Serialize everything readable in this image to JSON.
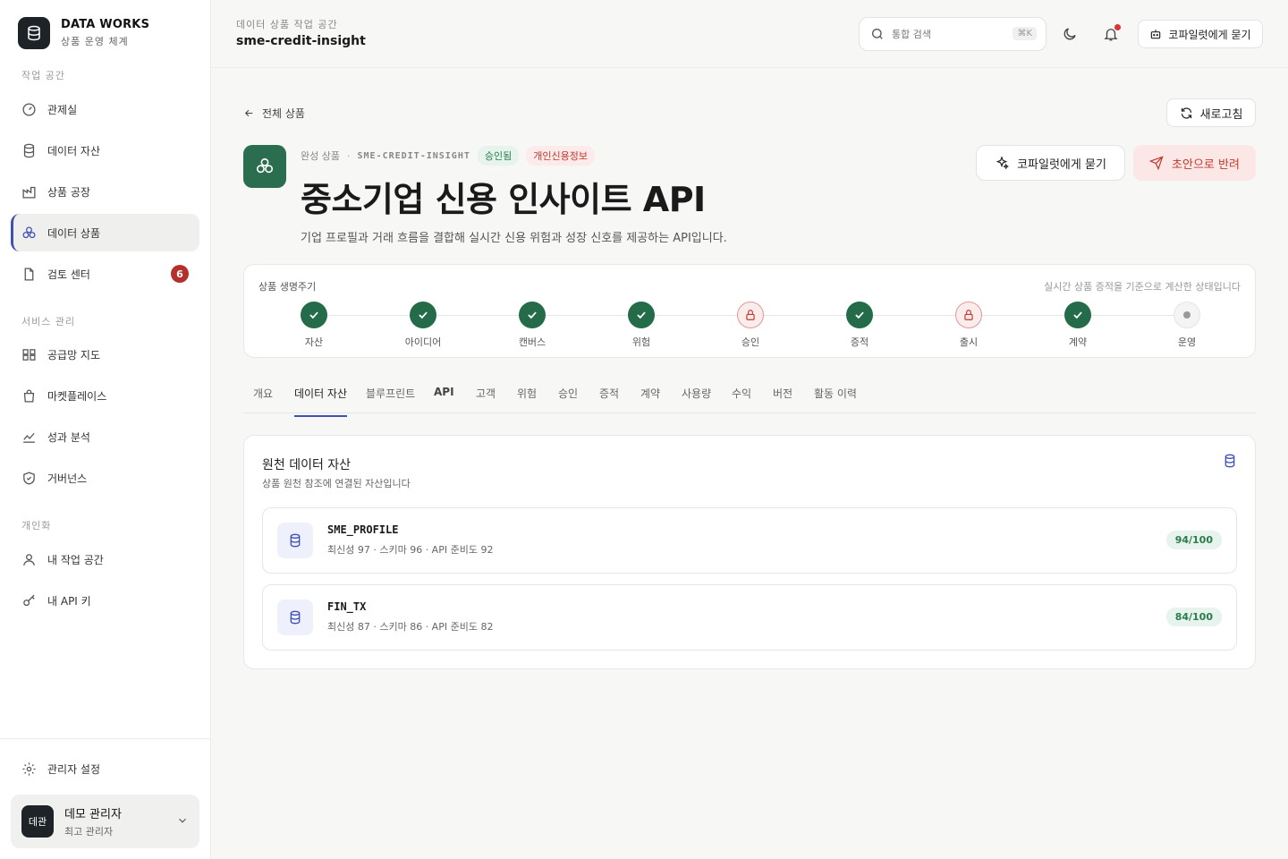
{
  "brand": {
    "title": "DATA WORKS",
    "subtitle": "상품 운영 체계"
  },
  "sidebar": {
    "section_workspace": "작업 공간",
    "section_service": "서비스 관리",
    "section_personal": "개인화",
    "items": [
      {
        "label": "관제실",
        "icon": "gauge-icon"
      },
      {
        "label": "데이터 자산",
        "icon": "database-icon"
      },
      {
        "label": "상품 공장",
        "icon": "factory-icon"
      },
      {
        "label": "데이터 상품",
        "icon": "cubes-icon",
        "active": true
      },
      {
        "label": "검토 센터",
        "icon": "file-check-icon",
        "badge": "6"
      },
      {
        "label": "공급망 지도",
        "icon": "network-icon"
      },
      {
        "label": "마켓플레이스",
        "icon": "store-icon"
      },
      {
        "label": "성과 분석",
        "icon": "chart-icon"
      },
      {
        "label": "거버넌스",
        "icon": "shield-icon"
      },
      {
        "label": "내 작업 공간",
        "icon": "user-icon"
      },
      {
        "label": "내 API 키",
        "icon": "key-icon"
      }
    ],
    "admin_settings": "관리자 설정",
    "user": {
      "avatar": "데관",
      "name": "데모 관리자",
      "role": "최고 관리자"
    }
  },
  "topbar": {
    "crumb_sub": "데이터 상품 작업 공간",
    "crumb_title": "sme-credit-insight",
    "search_placeholder": "통합 검색",
    "search_shortcut": "⌘K",
    "copilot_label": "코파일럿에게 묻기"
  },
  "page": {
    "back_label": "전체 상품",
    "refresh_label": "새로고침",
    "meta_status": "완성 상품",
    "meta_code": "SME-CREDIT-INSIGHT",
    "pill_approved": "승인됨",
    "pill_pii": "개인신용정보",
    "title_main": "중소기업 신용 인사이트 ",
    "title_bold": "API",
    "description": "기업 프로필과 거래 흐름을 결합해 실시간 신용 위험과 성장 신호를 제공하는 API입니다.",
    "btn_copilot": "코파일럿에게 묻기",
    "btn_return": "초안으로 반려"
  },
  "lifecycle": {
    "title": "상품 생명주기",
    "note": "실시간 상품 증적을 기준으로 계산한 상태입니다",
    "steps": [
      {
        "label": "자산",
        "state": "done"
      },
      {
        "label": "아이디어",
        "state": "done"
      },
      {
        "label": "캔버스",
        "state": "done"
      },
      {
        "label": "위험",
        "state": "done"
      },
      {
        "label": "승인",
        "state": "locked"
      },
      {
        "label": "증적",
        "state": "done"
      },
      {
        "label": "출시",
        "state": "locked"
      },
      {
        "label": "계약",
        "state": "done"
      },
      {
        "label": "운영",
        "state": "pending"
      }
    ]
  },
  "tabs": [
    "개요",
    "데이터 자산",
    "블루프린트",
    "API",
    "고객",
    "위험",
    "승인",
    "증적",
    "계약",
    "사용량",
    "수익",
    "버전",
    "활동 이력"
  ],
  "active_tab": "데이터 자산",
  "assets": {
    "title": "원천 데이터 자산",
    "subtitle": "상품 원천 참조에 연결된 자산입니다",
    "rows": [
      {
        "name": "SME_PROFILE",
        "meta": "최신성 97 · 스키마 96 · API 준비도 92",
        "score": "94/100"
      },
      {
        "name": "FIN_TX",
        "meta": "최신성 87 · 스키마 86 · API 준비도 82",
        "score": "84/100"
      }
    ]
  },
  "colors": {
    "accent": "#3f51b5",
    "brand_green": "#236b49",
    "danger": "#c0392b"
  }
}
